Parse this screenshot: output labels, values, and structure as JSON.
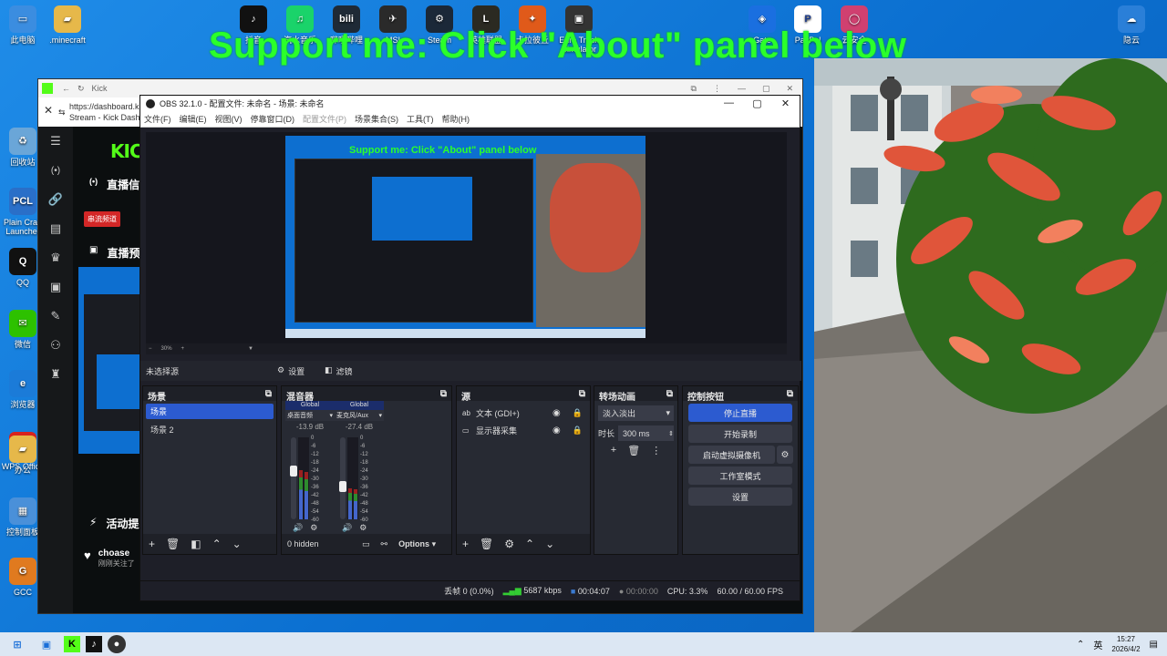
{
  "overlay_text": "Support me: Click \"About\" panel below",
  "desktop_left": [
    {
      "label": "此电脑",
      "color": "#3b8de0",
      "g": "▭"
    },
    {
      "label": ".minecraft",
      "color": "#e6b84a",
      "g": "▰"
    },
    {
      "label": "回收站",
      "color": "#6aa6d8",
      "g": "♻"
    },
    {
      "label": "Plain Craft Launcher",
      "color": "#2a6fc8",
      "g": "PCL"
    },
    {
      "label": "QQ",
      "color": "#111",
      "g": "Q"
    },
    {
      "label": "微信",
      "color": "#2dc100",
      "g": "✉"
    },
    {
      "label": "浏览器",
      "color": "#1b7bd8",
      "g": "e"
    },
    {
      "label": "WPS Office",
      "color": "#d7231e",
      "g": "W"
    },
    {
      "label": "办公",
      "color": "#e6b84a",
      "g": "▰"
    },
    {
      "label": "控制面板",
      "color": "#4a90d9",
      "g": "▦"
    },
    {
      "label": "GCC",
      "color": "#e07a1f",
      "g": "G"
    }
  ],
  "desktop_top": [
    {
      "label": "抖音",
      "color": "#111",
      "g": "♪"
    },
    {
      "label": "汽水音乐",
      "color": "#1ad36a",
      "g": "♫"
    },
    {
      "label": "哔哩哔哩",
      "color": "#1f2a36",
      "g": "bili"
    },
    {
      "label": "MSI",
      "color": "#2a2a2a",
      "g": "✈"
    },
    {
      "label": "Steam",
      "color": "#1b2838",
      "g": "⚙"
    },
    {
      "label": "英雄联盟",
      "color": "#2b2a22",
      "g": "L"
    },
    {
      "label": "卡拉彼丘",
      "color": "#e05a1a",
      "g": "✦"
    },
    {
      "label": "Euro Truck Simulator",
      "color": "#333",
      "g": "▣"
    },
    {
      "label": "Gate",
      "color": "#1a6fe0",
      "g": "◈"
    },
    {
      "label": "PayPal",
      "color": "#fff",
      "g": "P"
    },
    {
      "label": "云安全",
      "color": "#d04070",
      "g": "◯"
    },
    {
      "label": "隐云",
      "color": "#2a7fd8",
      "g": "☁"
    }
  ],
  "kick": {
    "tab_title": "Kick",
    "url": "https://dashboard.kick.com",
    "page_title": "Stream - Kick Dashboard",
    "logo": "KICK",
    "section_live": "直播信息",
    "live_badge": "串流频道",
    "section_preview": "直播预览",
    "section_activity": "活动提要",
    "follower_name": "choase",
    "follower_note": "刚刚关注了"
  },
  "obs": {
    "title": "OBS 32.1.0 - 配置文件: 未命名 - 场景: 未命名",
    "menu": [
      "文件(F)",
      "编辑(E)",
      "视图(V)",
      "停靠窗口(D)",
      "配置文件(P)",
      "场景集合(S)",
      "工具(T)",
      "帮助(H)"
    ],
    "zoom": "30%",
    "no_source": "未选择源",
    "settings_btn": "设置",
    "filters_btn": "滤镜",
    "scenes_title": "场景",
    "scenes": [
      "场景",
      "场景 2"
    ],
    "mixer_title": "混音器",
    "mixer": [
      {
        "scope": "Global",
        "name": "桌面音频",
        "db": "-13.9 dB",
        "level": 0.6
      },
      {
        "scope": "Global",
        "name": "麦克风/Aux",
        "db": "-27.4 dB",
        "level": 0.38
      }
    ],
    "scale": [
      "0",
      "-6",
      "-12",
      "-18",
      "-24",
      "-30",
      "-36",
      "-42",
      "-48",
      "-54",
      "-60"
    ],
    "hidden": "0 hidden",
    "options": "Options",
    "sources_title": "源",
    "sources": [
      "文本 (GDI+)",
      "显示器采集"
    ],
    "transitions_title": "转场动画",
    "transition_value": "淡入淡出",
    "duration_label": "时长",
    "duration_value": "300 ms",
    "controls_title": "控制按钮",
    "controls": {
      "stop_stream": "停止直播",
      "start_record": "开始录制",
      "virtual_cam": "启动虚拟摄像机",
      "studio": "工作室模式",
      "settings": "设置"
    },
    "status": {
      "dropped": "丢帧 0 (0.0%)",
      "bitrate": "5687 kbps",
      "live_time": "00:04:07",
      "rec_time": "00:00:00",
      "cpu": "CPU: 3.3%",
      "fps": "60.00 / 60.00 FPS"
    }
  },
  "taskbar": {
    "lang": "英",
    "time": "15:27",
    "date": "2026/4/2"
  }
}
